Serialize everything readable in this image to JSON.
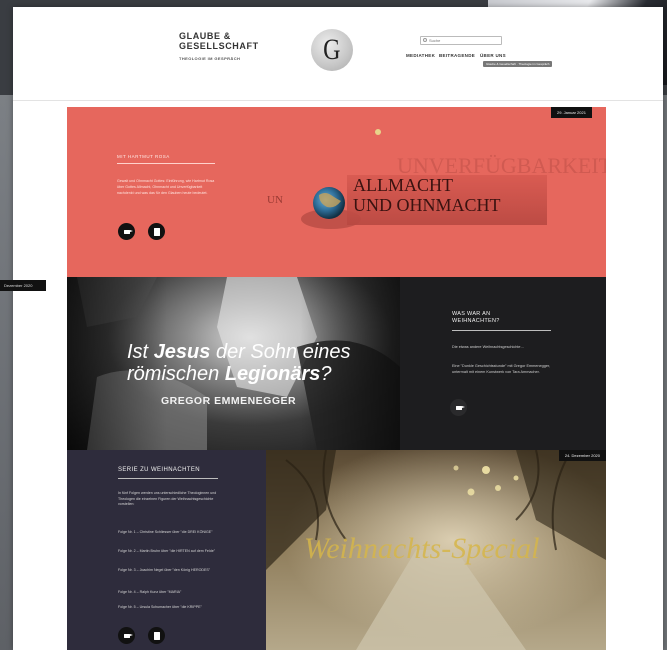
{
  "site": {
    "brand_line1": "GLAUBE &",
    "brand_line2": "GESELLSCHAFT",
    "brand_sub": "THEOLOGIE IM GESPRÄCH",
    "logo_letter": "G",
    "search_placeholder": "Suche",
    "nav": [
      "MEDIATHEK",
      "BEITRAGENDE",
      "ÜBER UNS"
    ],
    "tooltip": "Glaube & Gesellschaft · Theologie im Gespräch"
  },
  "panel1": {
    "date": "29. Januar 2021",
    "author": "MIT HARTMUT ROSA",
    "text": "Gewalt und Ohnmacht Gottes: Einführung, wie Hartmut Rosa über Gottes Allmacht, Ohnmacht und Unverfügbarkeit nachdenkt und was das für den Glauben heute bedeutet.",
    "art_headline_1": "ALLMACHT",
    "art_headline_2": "UND OHNMACHT",
    "art_bg_text": "UNVERFÜGBARKEIT",
    "art_small": "UN"
  },
  "panel2": {
    "side_date": "Dezember 2020",
    "head_pre": "Ist",
    "head_bold1": "Jesus",
    "head_mid": " der Sohn eines",
    "head_line2": "römischen",
    "head_bold2": "Legionärs",
    "head_end": "?",
    "subtitle": "GREGOR EMMENEGGER",
    "title_line1": "WAS WAR AN",
    "title_line2": "WEIHNACHTEN?",
    "text1": "Die etwas andere Weihnachtsgeschichte…",
    "text2": "Eine \"Dunkle Geschichtsstunde\" mit Gregor Emmenegger, untermalt mit einem Kunstwerk von Tara Ammacher."
  },
  "panel3": {
    "date": "24. Dezember 2020",
    "title": "SERIE ZU WEIHNACHTEN",
    "intro": "In fünf Folgen werden uns unterschiedliche Theologinnen und Theologen die einzelnen Figuren der Weihnachtsgeschichte vorstellen:",
    "episodes": [
      "Folge Nr. 1 – Christine Schliesser über \"die DREI KÖNIGE\"",
      "Folge Nr. 2 – Martin Bruhn über \"die HIRTEN auf dem Felde\"",
      "Folge Nr. 3 – Joachim Negel über \"den König HERODES\"",
      "Folge Nr. 4 – Ralph Kunz über \"MARIA\"",
      "Folge Nr. 5 – Ursula Schumacher über \"die KRIPPE\""
    ],
    "art_title": "Weihnachts-Special"
  },
  "colors": {
    "coral": "#e6675d",
    "dark": "#1d1d1f",
    "navy": "#2e2c3c",
    "gold": "#d6b64a"
  },
  "icons": [
    "search-icon",
    "video-icon",
    "document-icon"
  ]
}
